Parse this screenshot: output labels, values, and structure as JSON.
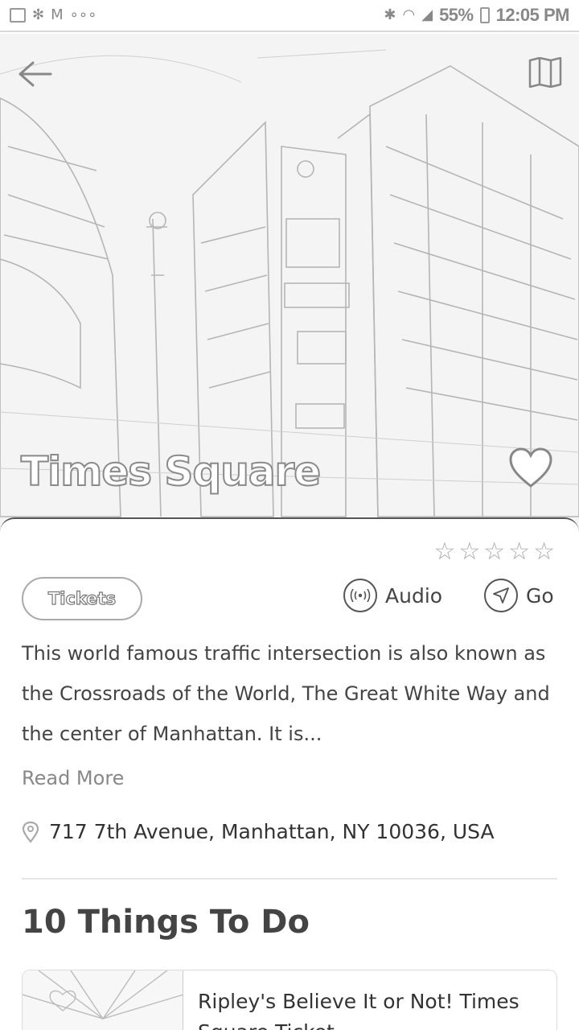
{
  "status_bar": {
    "battery": "55%",
    "time": "12:05 PM"
  },
  "hero": {
    "title": "Times Square"
  },
  "rating": {
    "stars": 0,
    "max": 5
  },
  "actions": {
    "tickets_label": "Tickets",
    "audio_label": "Audio",
    "go_label": "Go"
  },
  "description": {
    "text": "This world famous traffic intersection is also known as the Crossroads of the World, The Great White Way and the center of Manhattan. It is...",
    "read_more": "Read More"
  },
  "address": "717 7th Avenue, Manhattan, NY 10036, USA",
  "things_to_do": {
    "title": "10 Things To Do",
    "items": [
      {
        "title": "Ripley's Believe It or Not! Times Square Ticket"
      }
    ]
  }
}
